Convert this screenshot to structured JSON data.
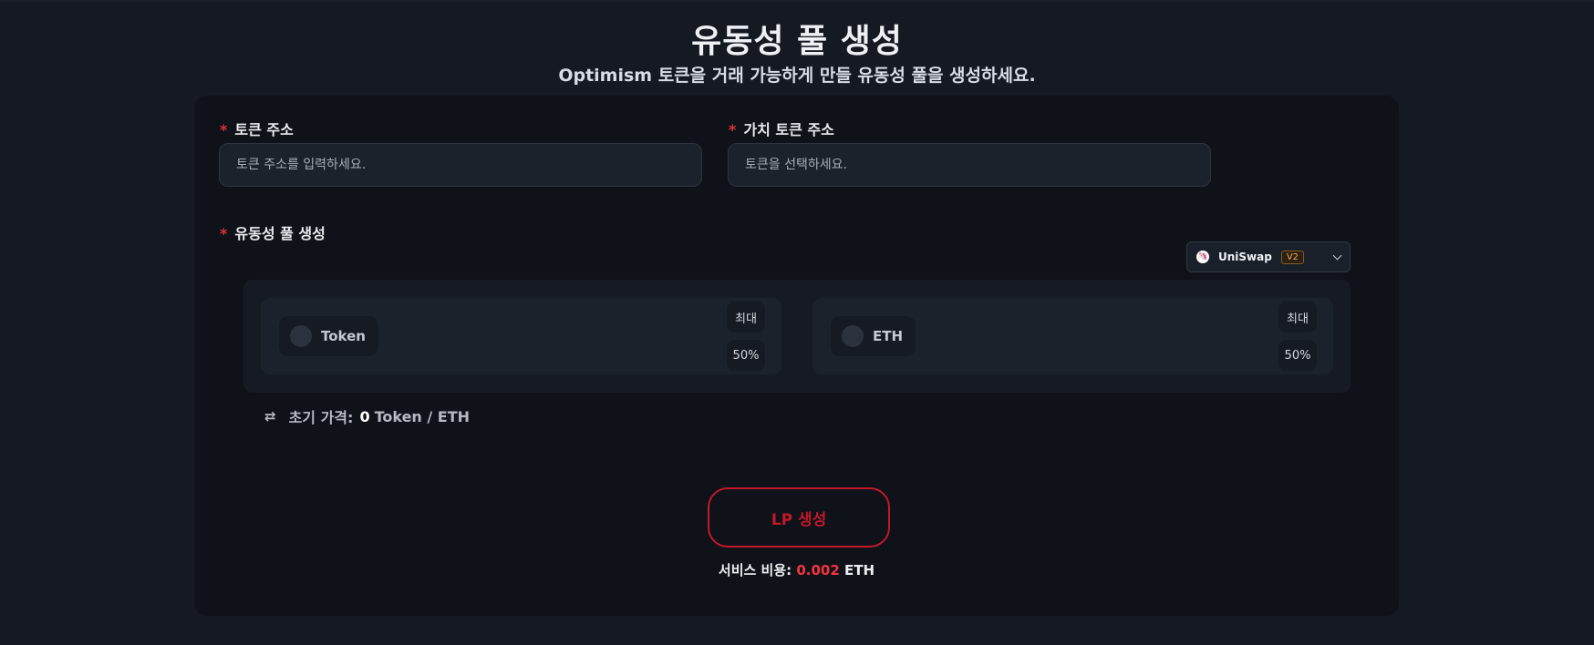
{
  "header": {
    "title": "유동성 풀 생성",
    "subtitle": "Optimism 토큰을 거래 가능하게 만들 유동성 풀을 생성하세요."
  },
  "form": {
    "required_mark": "*",
    "token_address": {
      "label": "토큰 주소",
      "placeholder": "토큰 주소를 입력하세요.",
      "value": ""
    },
    "pair_token_address": {
      "label": "가치 토큰 주소",
      "placeholder": "토큰을 선택하세요.",
      "value": ""
    }
  },
  "pool": {
    "label": "유동성 풀 생성",
    "dex": {
      "name": "UniSwap",
      "version": "V2",
      "icon": "unicorn-icon"
    },
    "token_a": {
      "name": "Token",
      "max_label": "최대",
      "pct_label": "50%"
    },
    "token_b": {
      "name": "ETH",
      "max_label": "최대",
      "pct_label": "50%"
    }
  },
  "initial_price": {
    "label": "초기 가격:",
    "value": "0",
    "unit": "Token / ETH",
    "icon": "swap-arrows-icon"
  },
  "submit": {
    "label": "LP 생성"
  },
  "fee": {
    "label": "서비스 비용:",
    "value": "0.002",
    "unit": "ETH"
  },
  "colors": {
    "background": "#141922",
    "card": "#0f1218",
    "accent_red": "#c4182a",
    "required_red": "#e0303a",
    "badge_orange": "#f3a94a"
  }
}
